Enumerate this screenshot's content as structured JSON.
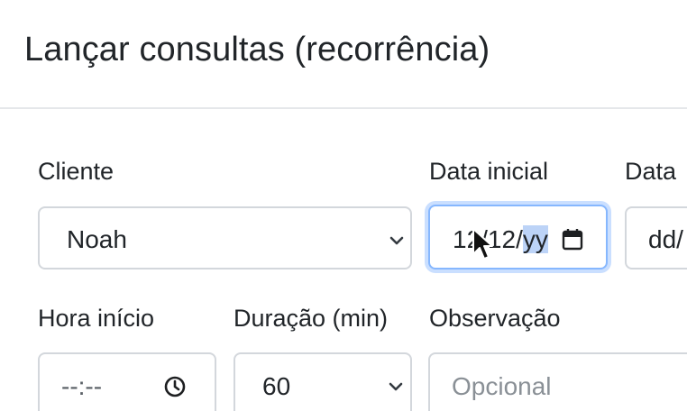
{
  "modal": {
    "title": "Lançar consultas (recorrência)"
  },
  "form": {
    "cliente": {
      "label": "Cliente",
      "value": "Noah"
    },
    "data_inicial": {
      "label": "Data inicial",
      "value_main": "12/12/",
      "value_selected": "yy",
      "calendar_icon": "calendar-icon"
    },
    "data_final": {
      "label": "Data",
      "value": "dd/"
    },
    "hora_inicio": {
      "label": "Hora início",
      "value": "--:--",
      "clock_icon": "clock-icon"
    },
    "duracao": {
      "label": "Duração (min)",
      "value": "60"
    },
    "observacao": {
      "label": "Observação",
      "placeholder": "Opcional"
    }
  },
  "colors": {
    "focus_border": "#86b7fe",
    "input_border": "#d3d7dc",
    "selection": "#bcd3f7"
  }
}
